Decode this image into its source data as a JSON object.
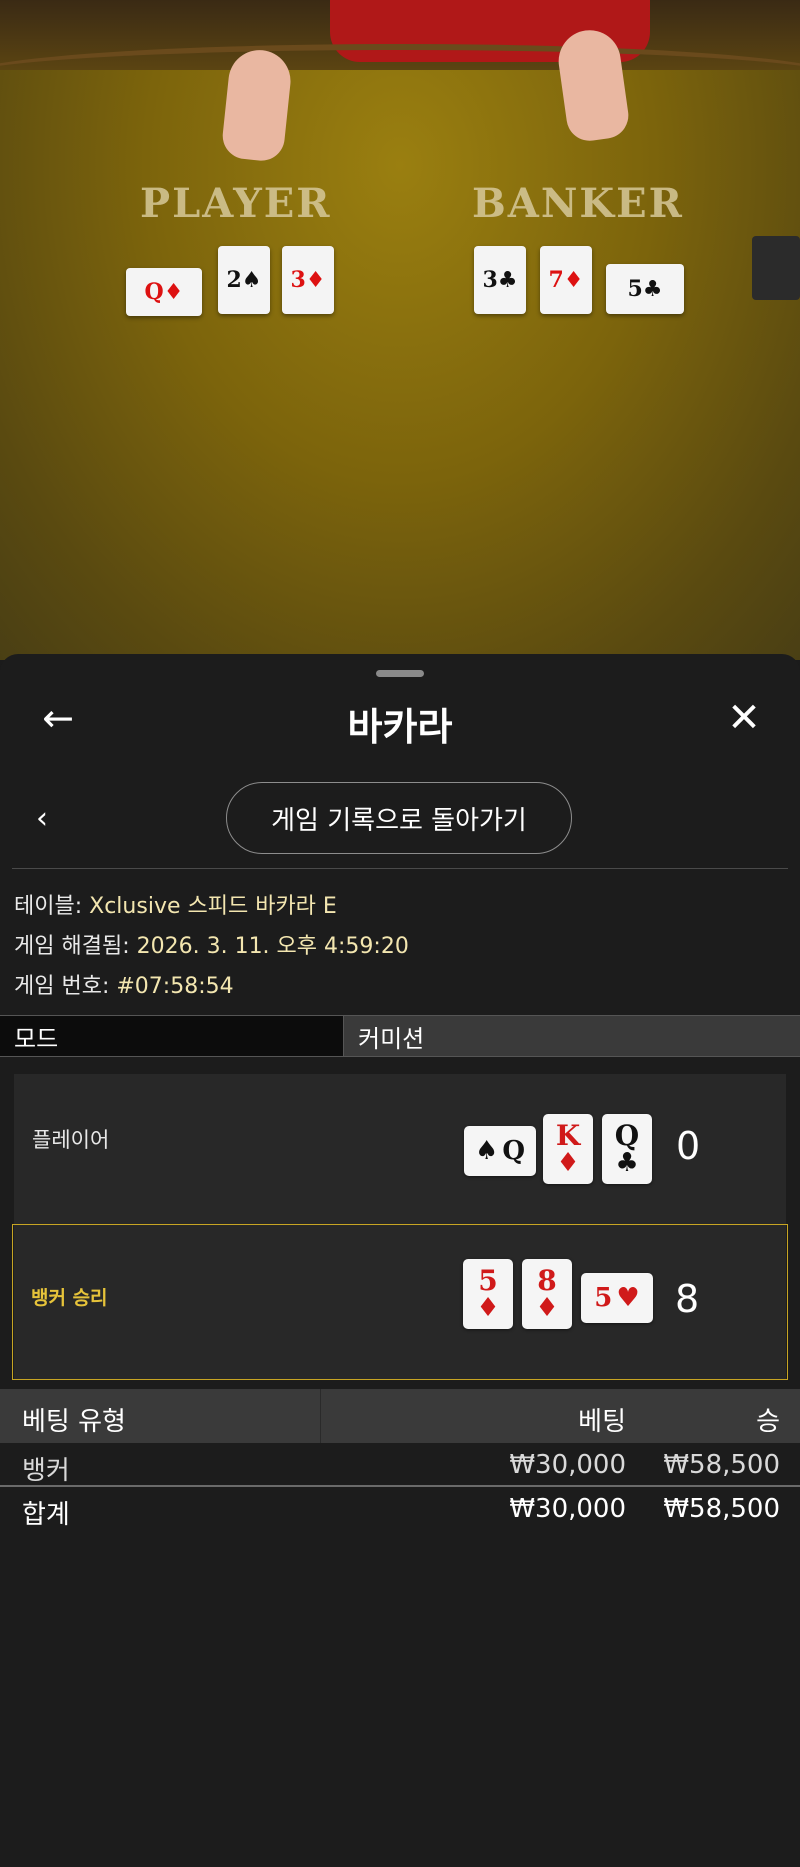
{
  "video": {
    "player_label": "PLAYER",
    "banker_label": "BANKER",
    "player_cards": [
      {
        "rank": "Q",
        "suit": "♦",
        "color": "red"
      },
      {
        "rank": "2",
        "suit": "♠",
        "color": "black"
      },
      {
        "rank": "3",
        "suit": "♦",
        "color": "red"
      }
    ],
    "banker_cards": [
      {
        "rank": "3",
        "suit": "♣",
        "color": "black"
      },
      {
        "rank": "7",
        "suit": "♦",
        "color": "red"
      },
      {
        "rank": "5",
        "suit": "♣",
        "color": "black"
      }
    ]
  },
  "header": {
    "back_icon": "arrow-left-icon",
    "title": "바카라",
    "close_icon": "close-icon"
  },
  "nav": {
    "prev_icon": "chevron-left-icon",
    "history_button": "게임 기록으로 돌아가기"
  },
  "info": {
    "table_label": "테이블:",
    "table_value": "Xclusive 스피드 바카라 E",
    "resolved_label": "게임 해결됨:",
    "resolved_value": "2026. 3. 11. 오후 4:59:20",
    "game_no_label": "게임 번호:",
    "game_no_value": "#07:58:54"
  },
  "mode": {
    "mode_label": "모드",
    "mode_value": "커미션"
  },
  "result": {
    "player": {
      "label": "플레이어",
      "score": "0",
      "cards": [
        {
          "rank": "Q",
          "suit": "♠",
          "color": "black",
          "orientation": "horizontal"
        },
        {
          "rank": "K",
          "suit": "♦",
          "color": "red",
          "orientation": "vertical"
        },
        {
          "rank": "Q",
          "suit": "♣",
          "color": "black",
          "orientation": "vertical"
        }
      ]
    },
    "banker": {
      "label": "뱅커 승리",
      "score": "8",
      "cards": [
        {
          "rank": "5",
          "suit": "♦",
          "color": "red",
          "orientation": "vertical"
        },
        {
          "rank": "8",
          "suit": "♦",
          "color": "red",
          "orientation": "vertical"
        },
        {
          "rank": "5",
          "suit": "♥",
          "color": "red",
          "orientation": "horizontal"
        }
      ]
    },
    "highlight_color": "#c7a523"
  },
  "bets": {
    "columns": [
      "베팅 유형",
      "베팅",
      "승"
    ],
    "rows": [
      {
        "type": "뱅커",
        "bet": "₩30,000",
        "win": "₩58,500"
      }
    ],
    "total": {
      "type": "합계",
      "bet": "₩30,000",
      "win": "₩58,500"
    }
  }
}
